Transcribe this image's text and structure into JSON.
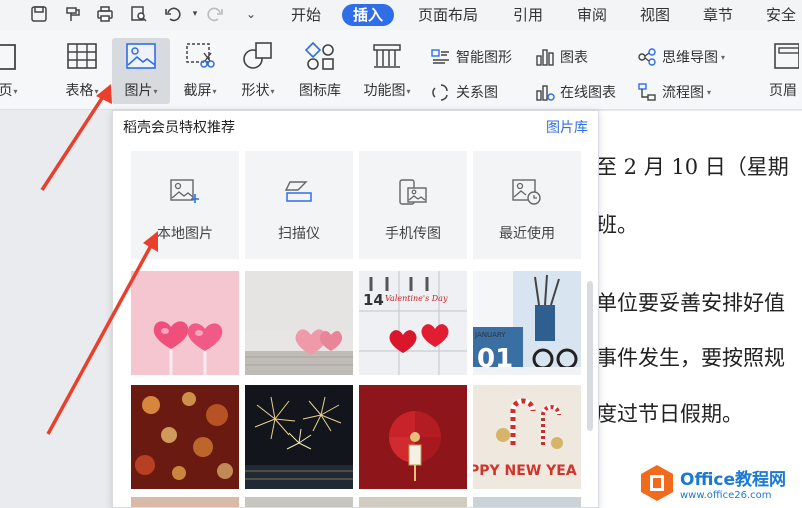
{
  "menubar": {
    "tabs": [
      {
        "label": "开始",
        "active": false
      },
      {
        "label": "插入",
        "active": true
      },
      {
        "label": "页面布局",
        "active": false
      },
      {
        "label": "引用",
        "active": false
      },
      {
        "label": "审阅",
        "active": false
      },
      {
        "label": "视图",
        "active": false
      },
      {
        "label": "章节",
        "active": false
      },
      {
        "label": "安全",
        "active": false
      }
    ],
    "quick_access_icons": [
      "save-icon",
      "format-painter-icon",
      "print-icon",
      "print-preview-icon",
      "undo-icon",
      "redo-icon",
      "more-icon"
    ]
  },
  "ribbon": {
    "big_buttons": [
      {
        "label": "页",
        "icon": "page-icon"
      },
      {
        "label": "表格",
        "icon": "table-icon",
        "dropdown": true
      },
      {
        "label": "图片",
        "icon": "picture-icon",
        "dropdown": true,
        "selected": true
      },
      {
        "label": "截屏",
        "icon": "screenshot-icon",
        "dropdown": true
      },
      {
        "label": "形状",
        "icon": "shapes-icon",
        "dropdown": true
      },
      {
        "label": "图标库",
        "icon": "icon-library-icon"
      },
      {
        "label": "功能图",
        "icon": "function-chart-icon",
        "dropdown": true
      },
      {
        "label": "页眉",
        "icon": "header-icon"
      }
    ],
    "small_buttons": [
      {
        "label": "智能图形",
        "icon": "smart-graphic-icon"
      },
      {
        "label": "图表",
        "icon": "chart-icon"
      },
      {
        "label": "思维导图",
        "icon": "mind-map-icon",
        "dropdown": true
      },
      {
        "label": "关系图",
        "icon": "relation-chart-icon"
      },
      {
        "label": "在线图表",
        "icon": "online-chart-icon"
      },
      {
        "label": "流程图",
        "icon": "flowchart-icon",
        "dropdown": true
      }
    ]
  },
  "panel": {
    "title": "稻壳会员特权推荐",
    "link": "图片库",
    "sources": [
      {
        "label": "本地图片",
        "icon": "local-image-icon"
      },
      {
        "label": "扫描仪",
        "icon": "scanner-icon"
      },
      {
        "label": "手机传图",
        "icon": "phone-transfer-icon"
      },
      {
        "label": "最近使用",
        "icon": "recent-use-icon"
      }
    ],
    "thumbnails": [
      {
        "name": "thumb-pink-heart-lollipops"
      },
      {
        "name": "thumb-pink-hearts-on-wood"
      },
      {
        "name": "thumb-valentines-calendar",
        "text": "Valentine's Day",
        "date_number": "14"
      },
      {
        "name": "thumb-january-calendar",
        "text": "JANUARY",
        "date_number": "01"
      },
      {
        "name": "thumb-red-bokeh"
      },
      {
        "name": "thumb-fireworks"
      },
      {
        "name": "thumb-red-fan-decoration"
      },
      {
        "name": "thumb-candy-cane-new-year",
        "text": "PPY NEW YEA"
      }
    ]
  },
  "document": {
    "lines": [
      "至 2 月 10 日（星期",
      "班。",
      "单位要妥善安排好值",
      "事件发生，要按照规",
      "度过节日假期。"
    ]
  },
  "watermark": {
    "title": "Office教程网",
    "url": "www.office26.com"
  },
  "colors": {
    "accent": "#2f6ee6",
    "arrow": "#e8402c",
    "watermark_orange": "#f26a1b",
    "watermark_blue": "#1b79d6"
  }
}
